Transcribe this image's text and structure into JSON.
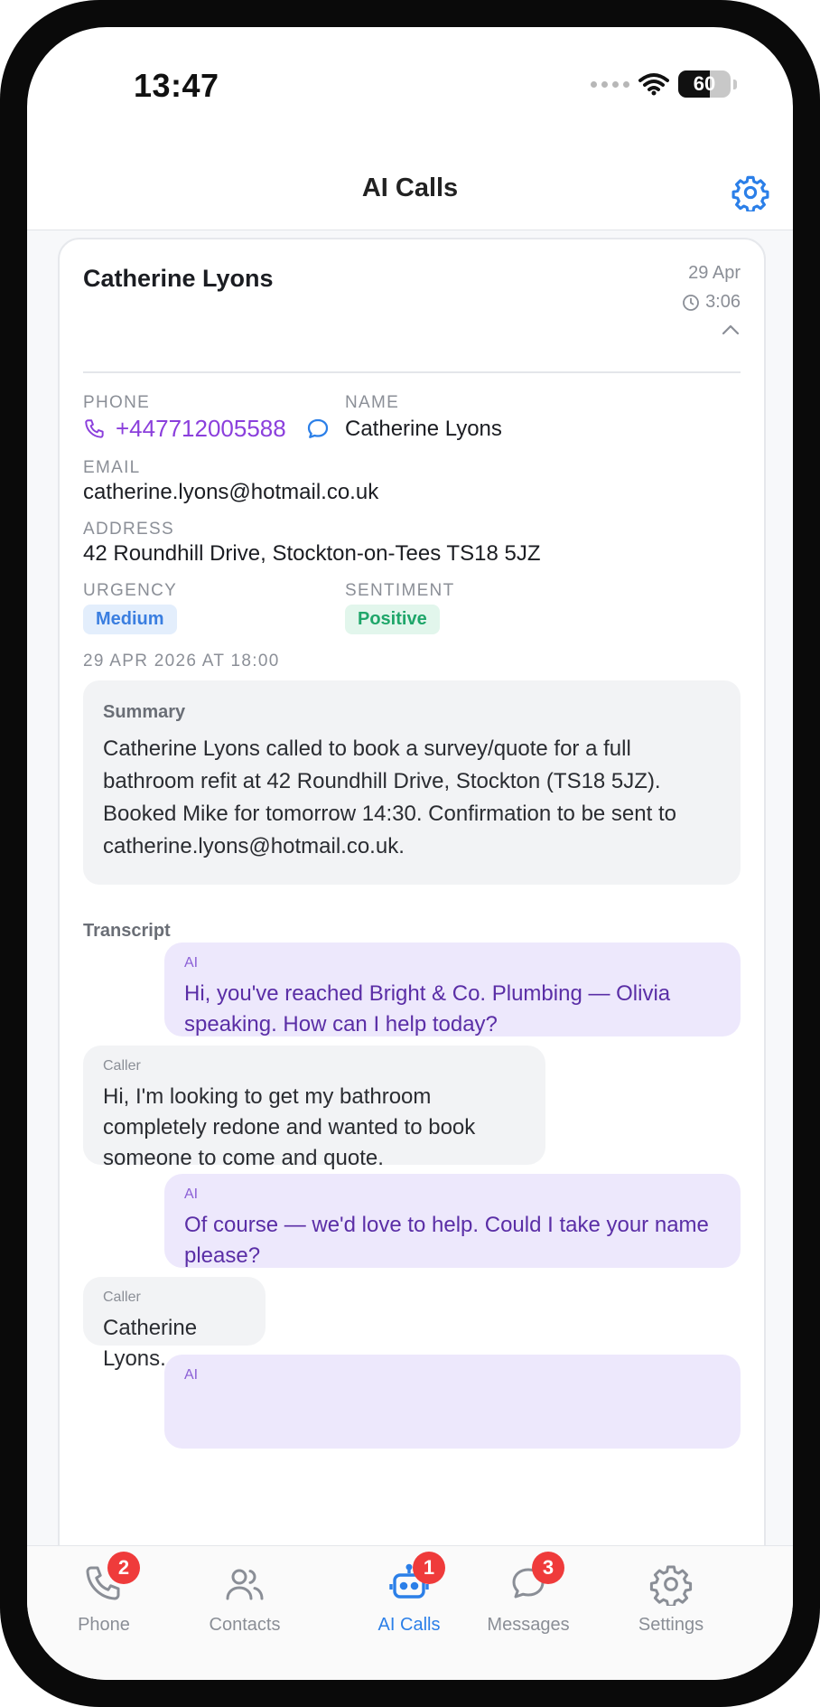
{
  "status_bar": {
    "time": "13:47",
    "battery": "60",
    "battery_level": 0.6
  },
  "header": {
    "title": "AI Calls"
  },
  "call": {
    "caller_name": "Catherine Lyons",
    "date": "29 Apr",
    "duration": "3:06",
    "phone_label": "PHONE",
    "phone": "+447712005588",
    "name_label": "NAME",
    "name": "Catherine Lyons",
    "email_label": "EMAIL",
    "email": "catherine.lyons@hotmail.co.uk",
    "address_label": "ADDRESS",
    "address": "42 Roundhill Drive, Stockton-on-Tees TS18 5JZ",
    "urgency_label": "URGENCY",
    "urgency": "Medium",
    "sentiment_label": "SENTIMENT",
    "sentiment": "Positive",
    "timestamp": "29 APR 2026 AT 18:00",
    "summary_title": "Summary",
    "summary": "Catherine Lyons called to book a survey/quote for a full bathroom refit at 42 Roundhill Drive, Stockton (TS18 5JZ). Booked Mike for tomorrow 14:30. Confirmation to be sent to catherine.lyons@hotmail.co.uk.",
    "transcript_title": "Transcript",
    "transcript": [
      {
        "speaker": "AI",
        "text": "Hi, you've reached Bright & Co. Plumbing — Olivia speaking. How can I help today?"
      },
      {
        "speaker": "Caller",
        "text": "Hi, I'm looking to get my bathroom completely redone and wanted to book someone to come and quote."
      },
      {
        "speaker": "AI",
        "text": "Of course — we'd love to help. Could I take your name please?"
      },
      {
        "speaker": "Caller",
        "text": "Catherine Lyons."
      },
      {
        "speaker": "AI",
        "text": ""
      }
    ]
  },
  "colors": {
    "accent": "#2b7fe8",
    "phone_purple": "#8b3fdc",
    "urgency_bg": "#e3eefc",
    "urgency_text": "#3a7ee0",
    "sentiment_bg": "#e2f6ec",
    "sentiment_text": "#1fa66a",
    "badge": "#ef3b3b",
    "tab_inactive": "#8a8e96"
  },
  "tabs": [
    {
      "label": "Phone",
      "icon": "phone-icon",
      "badge": "2",
      "active": false
    },
    {
      "label": "Contacts",
      "icon": "contacts-icon",
      "badge": "",
      "active": false
    },
    {
      "label": "AI Calls",
      "icon": "robot-icon",
      "badge": "1",
      "active": true
    },
    {
      "label": "Messages",
      "icon": "chat-icon",
      "badge": "3",
      "active": false
    },
    {
      "label": "Settings",
      "icon": "gear-icon",
      "badge": "",
      "active": false
    }
  ]
}
